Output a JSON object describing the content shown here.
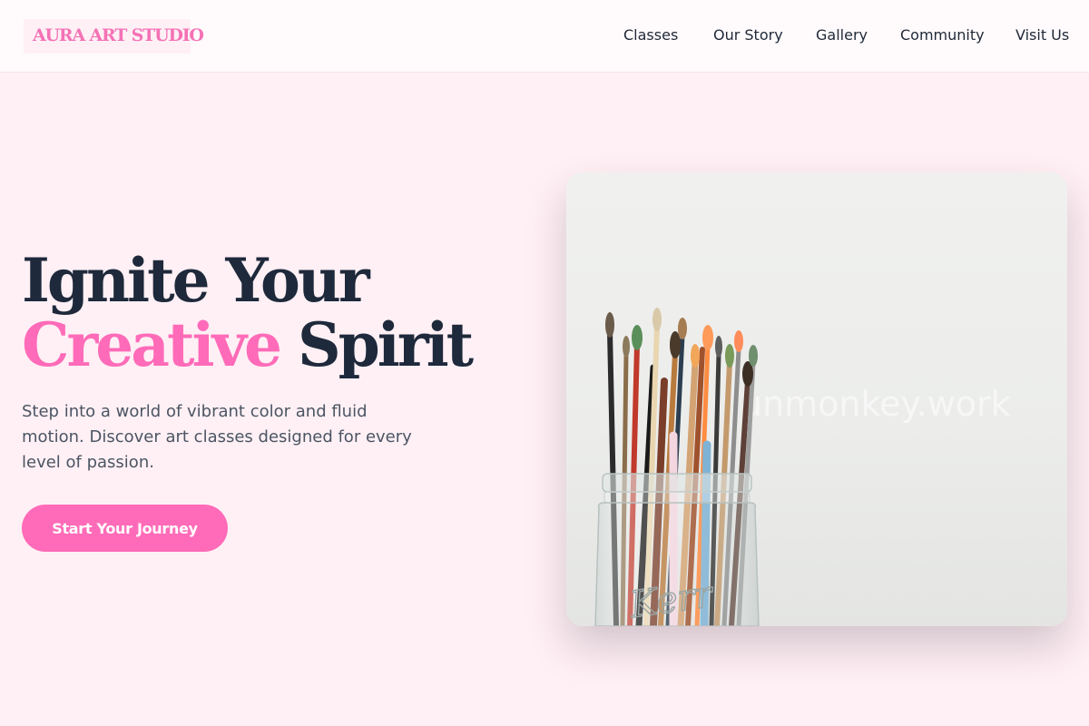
{
  "header": {
    "logo": "AURA ART STUDIO",
    "nav": [
      {
        "label": "Classes"
      },
      {
        "label": "Our Story"
      },
      {
        "label": "Gallery"
      },
      {
        "label": "Community"
      },
      {
        "label": "Visit Us"
      }
    ]
  },
  "hero": {
    "title_line1": "Ignite Your",
    "title_accent": "Creative",
    "title_rest": "Spirit",
    "description": "Step into a world of vibrant color and fluid motion. Discover art classes designed for every level of passion.",
    "cta_label": "Start Your Journey",
    "image": {
      "subject": "paintbrushes-in-glass-jar",
      "watermark": "unmonkey.work",
      "jar_lettering": "Kerr"
    }
  },
  "colors": {
    "background": "#fff0f5",
    "accent": "#ff6bb8",
    "logo": "#f472b6",
    "heading": "#1e293b",
    "body_text": "#4b5563"
  }
}
